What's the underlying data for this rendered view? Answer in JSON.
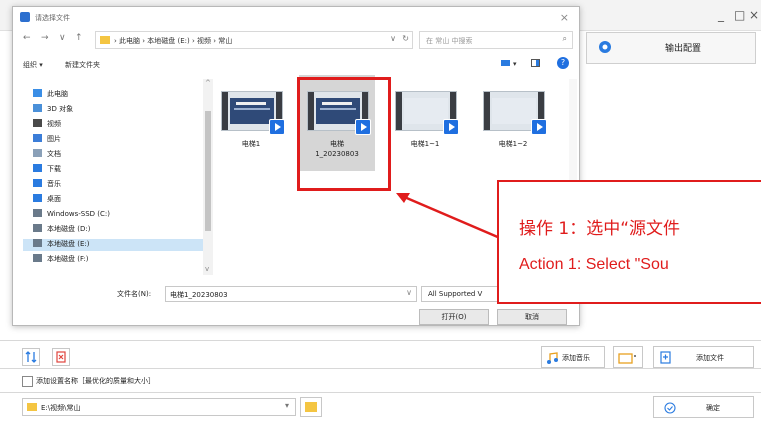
{
  "app": {
    "window_controls": [
      "_",
      "□",
      "×"
    ],
    "output_config_label": "输出配置",
    "add_music_label": "添加音乐",
    "add_file_label": "添加文件",
    "save_preset_label": "添加设置名称［最优化的质量和大小］",
    "output_path": "E:\\视频\\常山",
    "confirm_label": "确定"
  },
  "dialog": {
    "title": "请选择文件",
    "close": "×",
    "nav": {
      "back": "←",
      "forward": "→",
      "dropdown": "∨",
      "up": "↑"
    },
    "breadcrumb": "›  此电脑  ›  本地磁盘 (E:)  ›  视频  ›  常山",
    "search_placeholder": "在 常山 中搜索",
    "search_icon": "⌕",
    "refresh_icon": "↻",
    "commands": {
      "organize": "组织 ▾",
      "new_folder": "新建文件夹"
    },
    "help": "?",
    "nav_items": [
      {
        "label": "此电脑",
        "icon": "computer-icon"
      },
      {
        "label": "3D 对象",
        "icon": "cube-icon"
      },
      {
        "label": "视频",
        "icon": "video-icon"
      },
      {
        "label": "图片",
        "icon": "image-icon"
      },
      {
        "label": "文档",
        "icon": "document-icon"
      },
      {
        "label": "下载",
        "icon": "download-icon"
      },
      {
        "label": "音乐",
        "icon": "music-icon"
      },
      {
        "label": "桌面",
        "icon": "desktop-icon"
      },
      {
        "label": "Windows-SSD (C:)",
        "icon": "drive-icon"
      },
      {
        "label": "本地磁盘 (D:)",
        "icon": "drive-icon"
      },
      {
        "label": "本地磁盘 (E:)",
        "icon": "drive-icon",
        "selected": true
      },
      {
        "label": "本地磁盘 (F:)",
        "icon": "drive-icon"
      }
    ],
    "files": [
      {
        "name": "电梯1",
        "selected": false,
        "thumb": "pic"
      },
      {
        "name": "电梯\n1_20230803",
        "selected": true,
        "thumb": "pic"
      },
      {
        "name": "电梯1~1",
        "selected": false,
        "thumb": "blank"
      },
      {
        "name": "电梯1~2",
        "selected": false,
        "thumb": "blank"
      }
    ],
    "filename_label": "文件名(N):",
    "filename_value": "电梯1_20230803",
    "filetype_value": "All Supported V",
    "open_label": "打开(O)",
    "cancel_label": "取消"
  },
  "annotation": {
    "line1": "操作 1：选中“源文件",
    "line2": "Action 1: Select \"Sou",
    "color": "#e01c1c"
  }
}
